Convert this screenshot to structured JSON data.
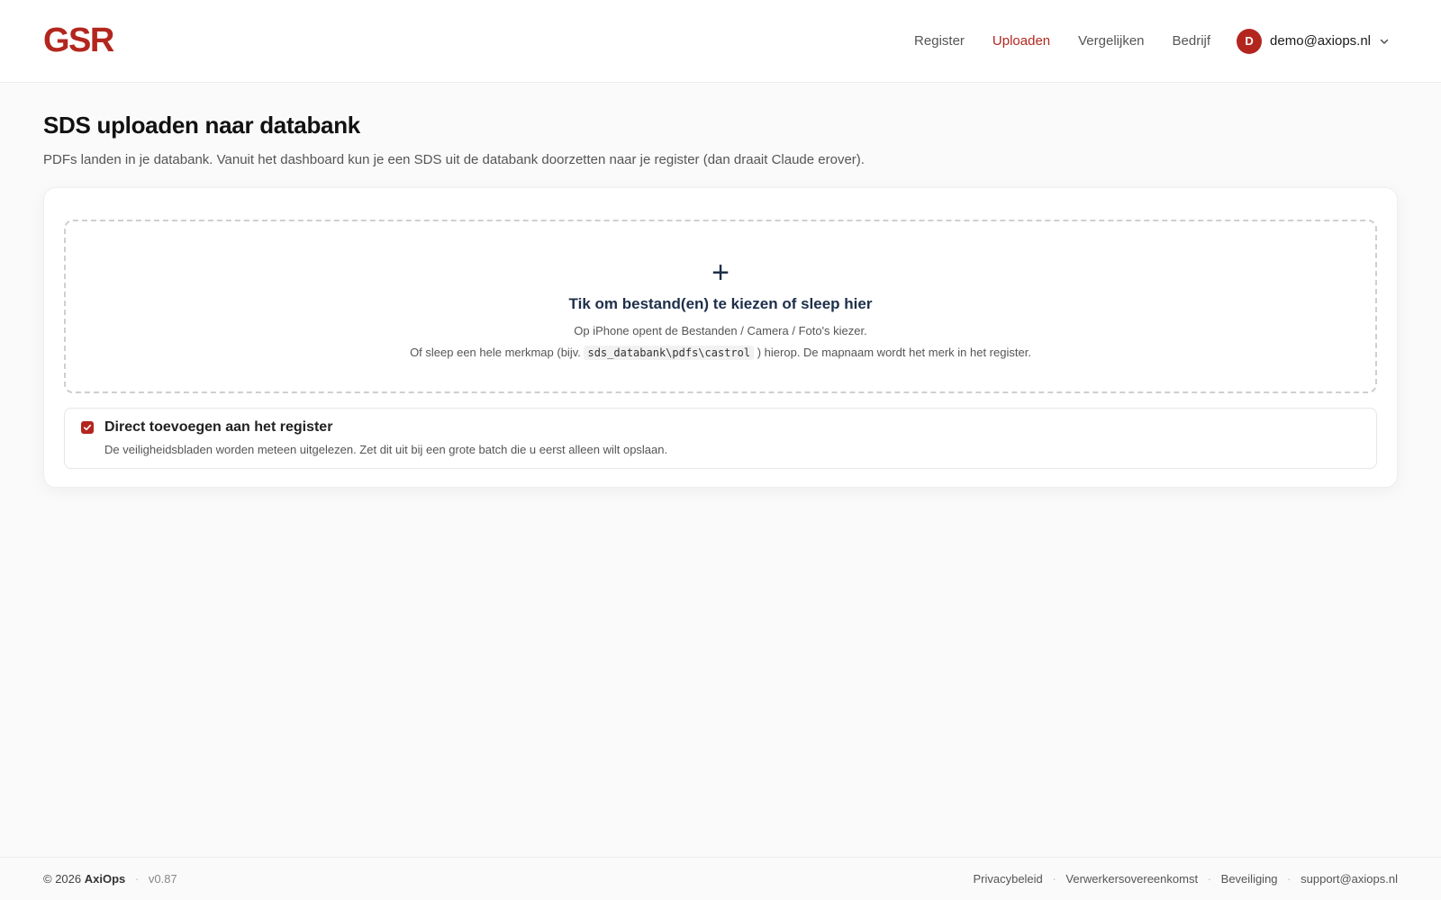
{
  "header": {
    "logo": "GSR",
    "nav": {
      "register": "Register",
      "uploaden": "Uploaden",
      "vergelijken": "Vergelijken",
      "bedrijf": "Bedrijf"
    },
    "user": {
      "initial": "D",
      "email": "demo@axiops.nl"
    }
  },
  "page": {
    "title": "SDS uploaden naar databank",
    "subtitle": "PDFs landen in je databank. Vanuit het dashboard kun je een SDS uit de databank doorzetten naar je register (dan draait Claude erover)."
  },
  "dropzone": {
    "icon": "plus-icon",
    "title": "Tik om bestand(en) te kiezen of sleep hier",
    "line1": "Op iPhone opent de Bestanden / Camera / Foto's kiezer.",
    "line2_prefix": "Of sleep een hele merkmap (bijv.",
    "line2_code": "sds_databank\\pdfs\\castrol",
    "line2_suffix": ") hierop. De mapnaam wordt het merk in het register."
  },
  "option": {
    "checked": true,
    "title": "Direct toevoegen aan het register",
    "description": "De veiligheidsbladen worden meteen uitgelezen. Zet dit uit bij een grote batch die u eerst alleen wilt opslaan."
  },
  "footer": {
    "copyright_prefix": "© 2026",
    "company": "AxiOps",
    "version": "v0.87",
    "links": {
      "privacy": "Privacybeleid",
      "processor": "Verwerkersovereenkomst",
      "security": "Beveiliging",
      "support": "support@axiops.nl"
    }
  },
  "colors": {
    "accent": "#b3261e",
    "heading_navy": "#1d2f4a"
  }
}
